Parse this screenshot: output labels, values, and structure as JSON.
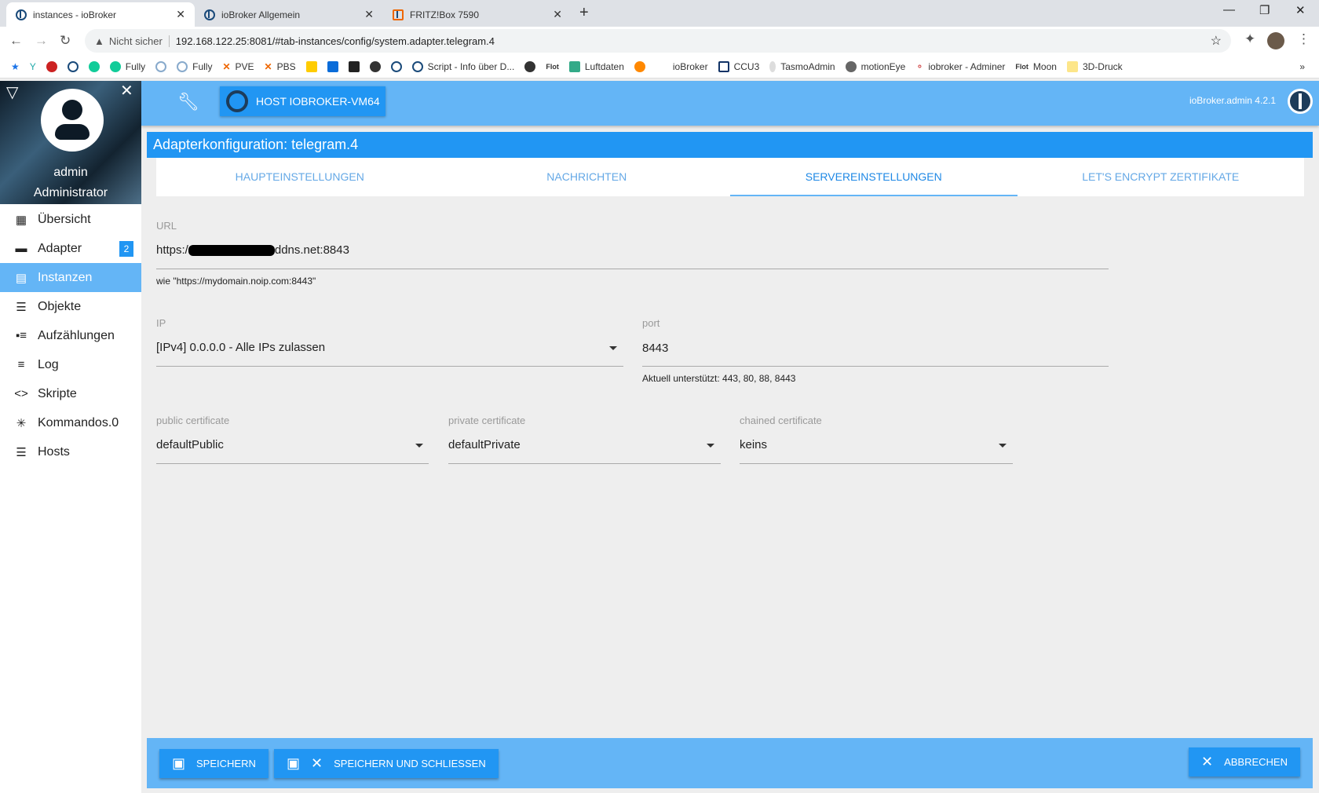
{
  "browser": {
    "tabs": [
      {
        "title": "instances - ioBroker"
      },
      {
        "title": "ioBroker Allgemein"
      },
      {
        "title": "FRITZ!Box 7590"
      }
    ],
    "security": "Nicht sicher",
    "url": "192.168.122.25:8081/#tab-instances/config/system.adapter.telegram.4",
    "bookmarks": [
      "Fully",
      "Fully",
      "PVE",
      "PBS",
      "Script - Info über D...",
      "Luftdaten",
      "ioBroker",
      "CCU3",
      "TasmoAdmin",
      "motionEye",
      "iobroker - Adminer",
      "Moon",
      "3D-Druck"
    ]
  },
  "header": {
    "host_button": "HOST IOBROKER-VM64",
    "version": "ioBroker.admin 4.2.1"
  },
  "sidebar": {
    "user": "admin",
    "role": "Administrator",
    "items": [
      {
        "label": "Übersicht"
      },
      {
        "label": "Adapter",
        "badge": "2"
      },
      {
        "label": "Instanzen"
      },
      {
        "label": "Objekte"
      },
      {
        "label": "Aufzählungen"
      },
      {
        "label": "Log"
      },
      {
        "label": "Skripte"
      },
      {
        "label": "Kommandos.0"
      },
      {
        "label": "Hosts"
      }
    ]
  },
  "main": {
    "title": "Adapterkonfiguration: telegram.4",
    "tabs": [
      "HAUPTEINSTELLUNGEN",
      "NACHRICHTEN",
      "SERVEREINSTELLUNGEN",
      "LET'S ENCRYPT ZERTIFIKATE"
    ],
    "url": {
      "label": "URL",
      "value_prefix": "https:/",
      "value_suffix": "ddns.net:8843",
      "help": "wie \"https://mydomain.noip.com:8443\""
    },
    "ip": {
      "label": "IP",
      "value": "[IPv4] 0.0.0.0 - Alle IPs zulassen"
    },
    "port": {
      "label": "port",
      "value": "8443",
      "help": "Aktuell unterstützt: 443, 80, 88, 8443"
    },
    "certs": [
      {
        "label": "public certificate",
        "value": "defaultPublic"
      },
      {
        "label": "private certificate",
        "value": "defaultPrivate"
      },
      {
        "label": "chained certificate",
        "value": "keins"
      }
    ]
  },
  "footer": {
    "save": "SPEICHERN",
    "save_close": "SPEICHERN UND SCHLIESSEN",
    "cancel": "ABBRECHEN"
  }
}
